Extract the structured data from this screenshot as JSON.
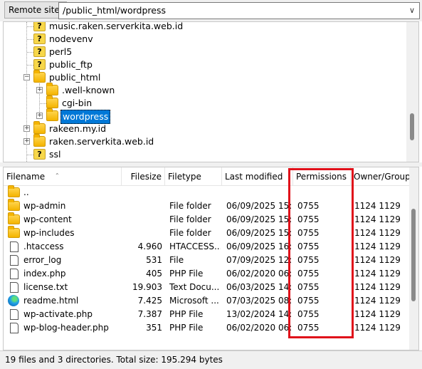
{
  "remote_site": {
    "label": "Remote site:",
    "path": "/public_html/wordpress"
  },
  "tree": {
    "items": [
      {
        "label": "music.raken.serverkita.web.id",
        "icon": "question-folder-icon",
        "level": 1
      },
      {
        "label": "nodevenv",
        "icon": "question-folder-icon",
        "level": 1
      },
      {
        "label": "perl5",
        "icon": "question-folder-icon",
        "level": 1
      },
      {
        "label": "public_ftp",
        "icon": "question-folder-icon",
        "level": 1
      },
      {
        "label": "public_html",
        "icon": "folder-icon",
        "level": 1,
        "expanded": true
      },
      {
        "label": ".well-known",
        "icon": "folder-icon",
        "level": 2
      },
      {
        "label": "cgi-bin",
        "icon": "folder-icon",
        "level": 2
      },
      {
        "label": "wordpress",
        "icon": "folder-icon",
        "level": 2,
        "selected": true
      },
      {
        "label": "rakeen.my.id",
        "icon": "folder-icon",
        "level": 1
      },
      {
        "label": "raken.serverkita.web.id",
        "icon": "folder-icon",
        "level": 1
      },
      {
        "label": "ssl",
        "icon": "question-folder-icon",
        "level": 1
      }
    ]
  },
  "file_list": {
    "columns": [
      "Filename",
      "Filesize",
      "Filetype",
      "Last modified",
      "Permissions",
      "Owner/Group"
    ],
    "rows": [
      {
        "name": "..",
        "size": "",
        "type": "",
        "modified": "",
        "perm": "",
        "owner": "",
        "icon": "folder-icon"
      },
      {
        "name": "wp-admin",
        "size": "",
        "type": "File folder",
        "modified": "06/09/2025 15:...",
        "perm": "0755",
        "owner": "1124 1129",
        "icon": "folder-icon"
      },
      {
        "name": "wp-content",
        "size": "",
        "type": "File folder",
        "modified": "06/09/2025 15:...",
        "perm": "0755",
        "owner": "1124 1129",
        "icon": "folder-icon"
      },
      {
        "name": "wp-includes",
        "size": "",
        "type": "File folder",
        "modified": "06/09/2025 15:...",
        "perm": "0755",
        "owner": "1124 1129",
        "icon": "folder-icon"
      },
      {
        "name": ".htaccess",
        "size": "4.960",
        "type": "HTACCESS...",
        "modified": "06/09/2025 16:...",
        "perm": "0755",
        "owner": "1124 1129",
        "icon": "file-icon"
      },
      {
        "name": "error_log",
        "size": "531",
        "type": "File",
        "modified": "07/09/2025 12:...",
        "perm": "0755",
        "owner": "1124 1129",
        "icon": "file-icon"
      },
      {
        "name": "index.php",
        "size": "405",
        "type": "PHP File",
        "modified": "06/02/2020 06:...",
        "perm": "0755",
        "owner": "1124 1129",
        "icon": "file-icon"
      },
      {
        "name": "license.txt",
        "size": "19.903",
        "type": "Text Docu...",
        "modified": "06/03/2025 14:...",
        "perm": "0755",
        "owner": "1124 1129",
        "icon": "file-icon"
      },
      {
        "name": "readme.html",
        "size": "7.425",
        "type": "Microsoft ...",
        "modified": "07/03/2025 08:...",
        "perm": "0755",
        "owner": "1124 1129",
        "icon": "edge-browser-icon"
      },
      {
        "name": "wp-activate.php",
        "size": "7.387",
        "type": "PHP File",
        "modified": "13/02/2024 14:...",
        "perm": "0755",
        "owner": "1124 1129",
        "icon": "file-icon"
      },
      {
        "name": "wp-blog-header.php",
        "size": "351",
        "type": "PHP File",
        "modified": "06/02/2020 06:...",
        "perm": "0755",
        "owner": "1124 1129",
        "icon": "file-icon"
      }
    ]
  },
  "status": {
    "text": "19 files and 3 directories. Total size: 195.294 bytes"
  },
  "colors": {
    "selection": "#0078d7",
    "highlight_box": "#e0101a",
    "folder": "#f4b400"
  }
}
